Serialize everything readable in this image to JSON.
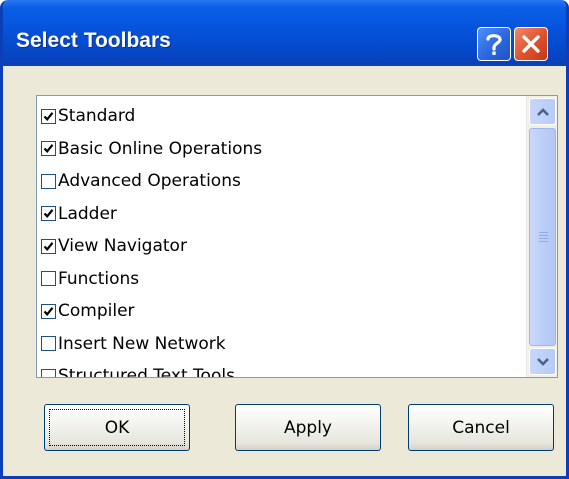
{
  "window": {
    "title": "Select Toolbars"
  },
  "titlebar_buttons": {
    "help_icon": "question-mark",
    "close_icon": "x-mark"
  },
  "toolbars_list": {
    "items": [
      {
        "label": "Standard",
        "checked": true
      },
      {
        "label": "Basic Online Operations",
        "checked": true
      },
      {
        "label": "Advanced Operations",
        "checked": false
      },
      {
        "label": "Ladder",
        "checked": true
      },
      {
        "label": "View Navigator",
        "checked": true
      },
      {
        "label": "Functions",
        "checked": false
      },
      {
        "label": "Compiler",
        "checked": true
      },
      {
        "label": "Insert New Network",
        "checked": false
      },
      {
        "label": "Structured Text Tools",
        "checked": false
      }
    ]
  },
  "buttons": {
    "ok": "OK",
    "apply": "Apply",
    "cancel": "Cancel"
  },
  "colors": {
    "titlebar": "#0654de",
    "close_button": "#e0512c",
    "dialog_background": "#ece9d8"
  }
}
